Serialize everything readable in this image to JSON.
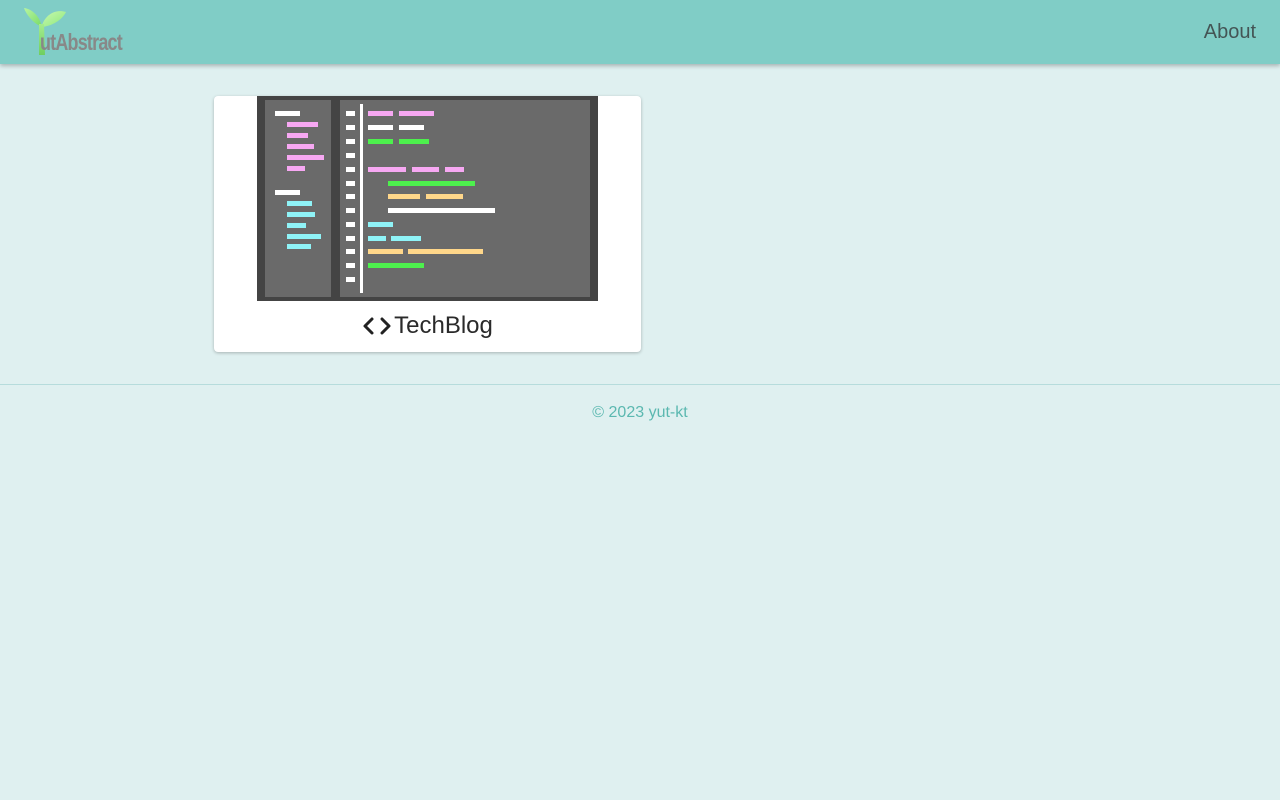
{
  "header": {
    "logo_text": "utAbstract",
    "nav": {
      "about_label": "About"
    },
    "background_color": "#80cdc6"
  },
  "main": {
    "cards": [
      {
        "title": "TechBlog",
        "icon": "code-icon",
        "image": "code-editor-illustration"
      }
    ]
  },
  "footer": {
    "copyright": "© 2023 yut-kt",
    "text_color": "#5bb8b0"
  },
  "colors": {
    "page_background": "#dff0f0",
    "editor_pink": "#f7a8f3",
    "editor_green": "#4df04d",
    "editor_cyan": "#8ff3f7",
    "editor_yellow": "#ffd78a"
  }
}
